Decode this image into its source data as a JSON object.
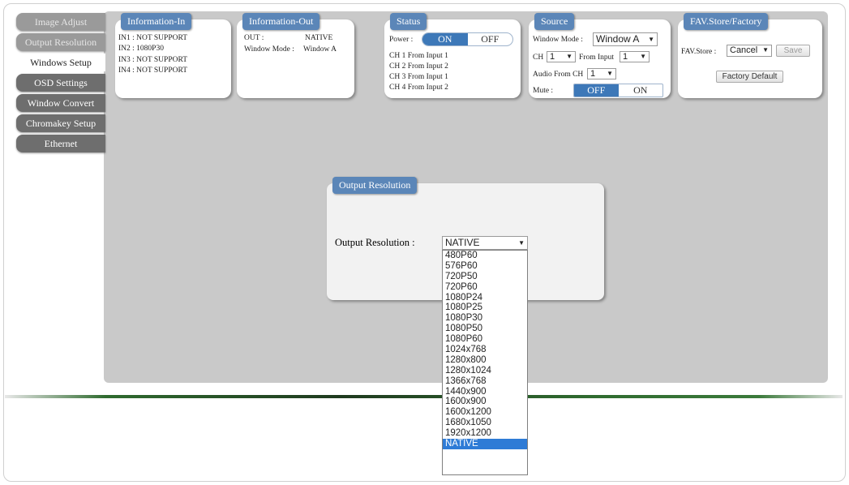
{
  "sidebar": {
    "items": [
      {
        "label": "Image Adjust",
        "state": "muted"
      },
      {
        "label": "Output Resolution",
        "state": "muted"
      },
      {
        "label": "Windows Setup",
        "state": "active"
      },
      {
        "label": "OSD Settings",
        "state": "normal"
      },
      {
        "label": "Window Convert",
        "state": "normal"
      },
      {
        "label": "Chromakey Setup",
        "state": "normal"
      },
      {
        "label": "Ethernet",
        "state": "normal"
      }
    ]
  },
  "info_in": {
    "title": "Information-In",
    "lines": [
      "IN1 : NOT SUPPORT",
      "IN2 : 1080P30",
      "IN3 : NOT SUPPORT",
      "IN4 : NOT SUPPORT"
    ]
  },
  "info_out": {
    "title": "Information-Out",
    "out_label": "OUT :",
    "out_value": "NATIVE",
    "window_mode_label": "Window Mode :",
    "window_mode_value": "Window A"
  },
  "status": {
    "title": "Status",
    "power_label": "Power :",
    "power_on": "ON",
    "power_off": "OFF",
    "lines": [
      "CH 1 From Input   1",
      "CH 2 From Input   2",
      "CH 3 From Input   1",
      "CH 4 From Input   2"
    ]
  },
  "source": {
    "title": "Source",
    "window_mode_label": "Window Mode :",
    "window_mode_value": "Window A",
    "ch_label": "CH",
    "ch_value": "1",
    "from_input_label": "From Input",
    "from_input_value": "1",
    "audio_label": "Audio From CH",
    "audio_value": "1",
    "mute_label": "Mute :",
    "mute_off": "OFF",
    "mute_on": "ON"
  },
  "fav": {
    "title": "FAV.Store/Factory",
    "store_label": "FAV.Store :",
    "store_value": "Cancel",
    "save_label": "Save",
    "factory_label": "Factory Default"
  },
  "output_resolution": {
    "title": "Output Resolution",
    "label": "Output Resolution :",
    "value": "NATIVE",
    "options": [
      "480P60",
      "576P60",
      "720P50",
      "720P60",
      "1080P24",
      "1080P25",
      "1080P30",
      "1080P50",
      "1080P60",
      "1024x768",
      "1280x800",
      "1280x1024",
      "1366x768",
      "1440x900",
      "1600x900",
      "1600x1200",
      "1680x1050",
      "1920x1200",
      "NATIVE"
    ],
    "highlighted": "NATIVE"
  },
  "colors": {
    "accent": "#5b86b8",
    "selected": "#2e7bd6",
    "panel": "#c9c9c9"
  }
}
